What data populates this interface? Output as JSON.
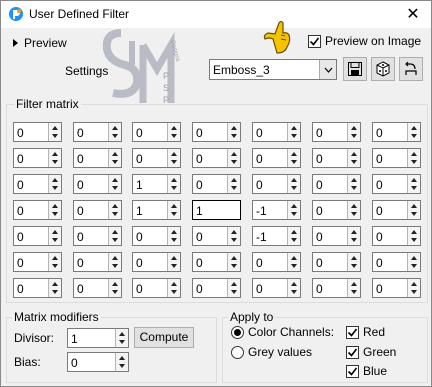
{
  "window": {
    "title": "User Defined Filter",
    "close_glyph": "✕"
  },
  "top": {
    "preview_label": "Preview",
    "settings_label": "Settings",
    "preview_on_image_label": "Preview on Image",
    "preview_on_image_checked": true,
    "preset_value": "Emboss_3"
  },
  "matrix": {
    "label": "Filter matrix",
    "rows": [
      [
        "0",
        "0",
        "0",
        "0",
        "0",
        "0",
        "0"
      ],
      [
        "0",
        "0",
        "0",
        "0",
        "0",
        "0",
        "0"
      ],
      [
        "0",
        "0",
        "1",
        "0",
        "0",
        "0",
        "0"
      ],
      [
        "0",
        "0",
        "1",
        "1",
        "-1",
        "0",
        "0"
      ],
      [
        "0",
        "0",
        "0",
        "0",
        "-1",
        "0",
        "0"
      ],
      [
        "0",
        "0",
        "0",
        "0",
        "0",
        "0",
        "0"
      ],
      [
        "0",
        "0",
        "0",
        "0",
        "0",
        "0",
        "0"
      ]
    ]
  },
  "modifiers": {
    "label": "Matrix modifiers",
    "divisor_label": "Divisor:",
    "divisor_value": "1",
    "bias_label": "Bias:",
    "bias_value": "0",
    "compute_label": "Compute"
  },
  "apply": {
    "label": "Apply to",
    "color_channels_label": "Color Channels:",
    "grey_values_label": "Grey values",
    "mode": "color",
    "red_label": "Red",
    "green_label": "Green",
    "blue_label": "Blue",
    "red_checked": true,
    "green_checked": true,
    "blue_checked": true
  },
  "watermark": {
    "letters": "SIM",
    "side_text": "PSP",
    "arc_text": "Designs"
  }
}
